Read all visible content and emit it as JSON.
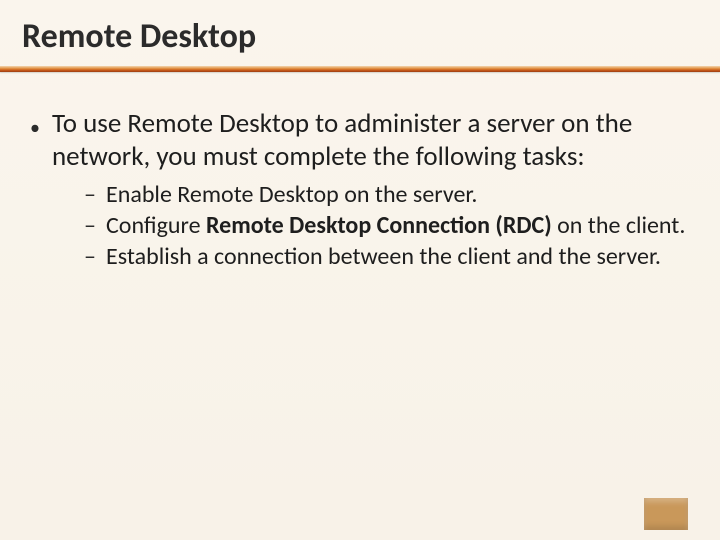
{
  "title": "Remote Desktop",
  "body": {
    "intro": "To use Remote Desktop to administer a server on the network, you must complete the following tasks:",
    "sub": {
      "item1": "Enable Remote Desktop on the server.",
      "item2_pre": "Configure ",
      "item2_bold": "Remote Desktop Connection (RDC) ",
      "item2_post": "on the client.",
      "item3": "Establish a connection between the client and the server."
    }
  }
}
